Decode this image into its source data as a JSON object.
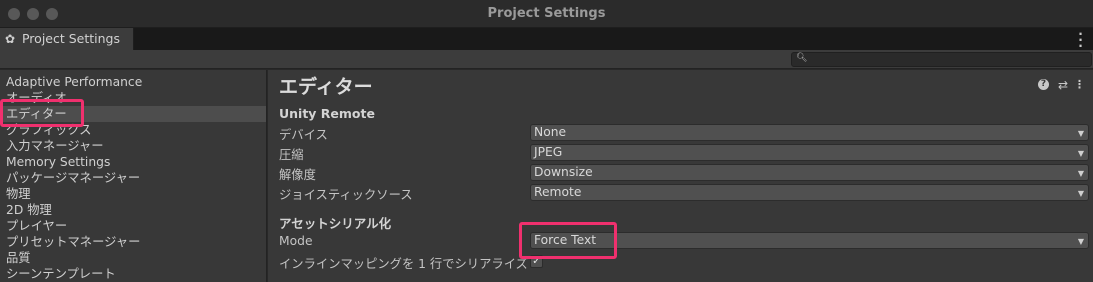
{
  "window": {
    "title": "Project Settings"
  },
  "tab": {
    "label": "Project Settings",
    "icon": "gear-icon"
  },
  "search": {
    "placeholder": "",
    "icon": "search-icon"
  },
  "sidebar": {
    "items": [
      {
        "label": "Adaptive Performance"
      },
      {
        "label": "オーディオ"
      },
      {
        "label": "エディター",
        "selected": true
      },
      {
        "label": "グラフィックス"
      },
      {
        "label": "入力マネージャー"
      },
      {
        "label": "Memory Settings"
      },
      {
        "label": "パッケージマネージャー"
      },
      {
        "label": "物理"
      },
      {
        "label": "2D 物理"
      },
      {
        "label": "プレイヤー"
      },
      {
        "label": "プリセットマネージャー"
      },
      {
        "label": "品質"
      },
      {
        "label": "シーンテンプレート"
      }
    ]
  },
  "main": {
    "title": "エディター",
    "header_icons": [
      "help-icon",
      "preset-icon",
      "more-icon"
    ],
    "unity_remote": {
      "heading": "Unity Remote",
      "device": {
        "label": "デバイス",
        "value": "None"
      },
      "compression": {
        "label": "圧縮",
        "value": "JPEG"
      },
      "resolution": {
        "label": "解像度",
        "value": "Downsize"
      },
      "joystick": {
        "label": "ジョイスティックソース",
        "value": "Remote"
      }
    },
    "asset_serialization": {
      "heading": "アセットシリアル化",
      "mode": {
        "label": "Mode",
        "value": "Force Text"
      },
      "inline": {
        "label": "インラインマッピングを 1 行でシリアライズ",
        "checked": true,
        "check_glyph": "✓"
      }
    }
  },
  "colors": {
    "highlight": "#f0306e",
    "background": "#383838",
    "selected_row": "#4d4d4d"
  }
}
